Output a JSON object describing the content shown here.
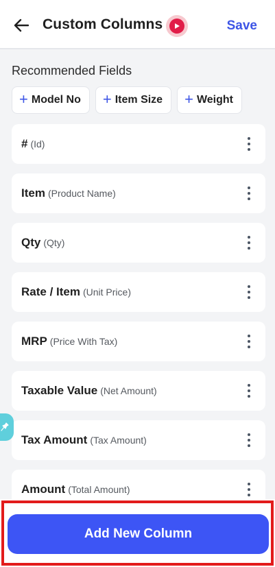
{
  "header": {
    "title": "Custom Columns",
    "save_label": "Save",
    "back_icon": "arrow-left-icon",
    "video_icon": "play-video-icon"
  },
  "recommended": {
    "heading": "Recommended Fields",
    "chips": [
      {
        "label": "Model No"
      },
      {
        "label": "Item Size"
      },
      {
        "label": "Weight"
      }
    ]
  },
  "columns": [
    {
      "name": "#",
      "sub": "(Id)"
    },
    {
      "name": "Item",
      "sub": "(Product Name)"
    },
    {
      "name": "Qty",
      "sub": "(Qty)"
    },
    {
      "name": "Rate / Item",
      "sub": "(Unit Price)"
    },
    {
      "name": "MRP",
      "sub": "(Price With Tax)"
    },
    {
      "name": "Taxable Value",
      "sub": "(Net Amount)"
    },
    {
      "name": "Tax Amount",
      "sub": "(Tax Amount)"
    },
    {
      "name": "Amount",
      "sub": "(Total Amount)"
    }
  ],
  "footer": {
    "add_label": "Add New Column"
  },
  "colors": {
    "accent": "#3d55f5",
    "highlight": "#e21b1b",
    "video": "#e11d48",
    "pin": "#5fcfdc"
  }
}
